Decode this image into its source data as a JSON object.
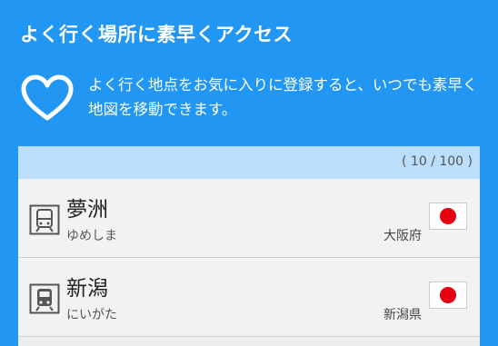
{
  "header": {
    "title": "よく行く場所に素早くアクセス",
    "description": "よく行く地点をお気に入りに登録すると、いつでも素早く地図を移動できます。",
    "icon": "heart-outline-icon"
  },
  "list": {
    "count_label": "( 10 / 100 )",
    "items": [
      {
        "name": "夢洲",
        "reading": "ゆめしま",
        "prefecture": "大阪府",
        "icon": "train-station-outline-icon",
        "flag": "japan-flag-icon"
      },
      {
        "name": "新潟",
        "reading": "にいがた",
        "prefecture": "新潟県",
        "icon": "train-station-filled-icon",
        "flag": "japan-flag-icon"
      }
    ]
  },
  "colors": {
    "background": "#2196f3",
    "list_header": "#bbdefb",
    "flag_red": "#e60012"
  }
}
